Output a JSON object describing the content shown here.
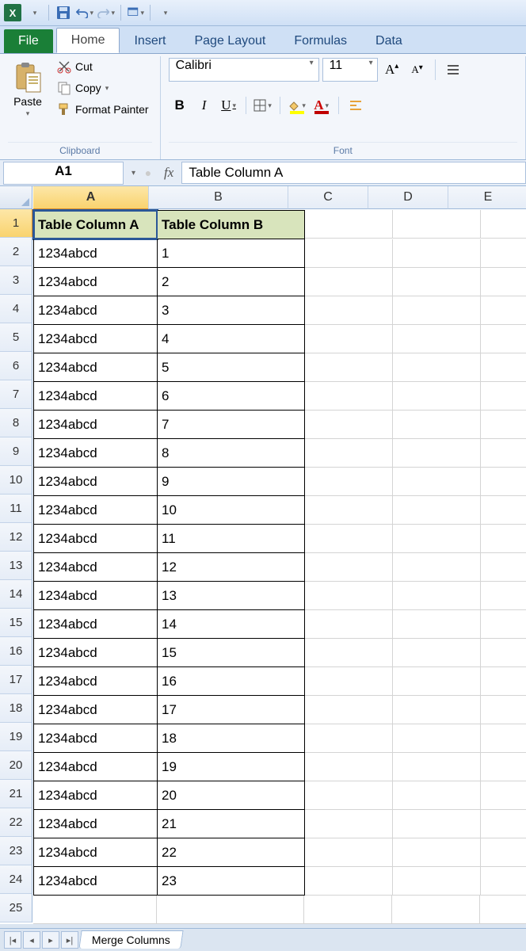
{
  "qat": {
    "save_title": "Save",
    "undo_title": "Undo",
    "redo_title": "Redo"
  },
  "tabs": {
    "file": "File",
    "home": "Home",
    "insert": "Insert",
    "page_layout": "Page Layout",
    "formulas": "Formulas",
    "data": "Data"
  },
  "ribbon": {
    "clipboard": {
      "label": "Clipboard",
      "paste": "Paste",
      "cut": "Cut",
      "copy": "Copy",
      "format_painter": "Format Painter"
    },
    "font": {
      "label": "Font",
      "name": "Calibri",
      "size": "11",
      "bold": "B",
      "italic": "I",
      "underline": "U"
    }
  },
  "namebox": {
    "ref": "A1",
    "fx": "fx",
    "formula": "Table Column A"
  },
  "columns": [
    "A",
    "B",
    "C",
    "D",
    "E"
  ],
  "row_count": 25,
  "table": {
    "headers": [
      "Table Column A",
      "Table Column B"
    ],
    "rows": [
      [
        "1234abcd",
        "1"
      ],
      [
        "1234abcd",
        "2"
      ],
      [
        "1234abcd",
        "3"
      ],
      [
        "1234abcd",
        "4"
      ],
      [
        "1234abcd",
        "5"
      ],
      [
        "1234abcd",
        "6"
      ],
      [
        "1234abcd",
        "7"
      ],
      [
        "1234abcd",
        "8"
      ],
      [
        "1234abcd",
        "9"
      ],
      [
        "1234abcd",
        "10"
      ],
      [
        "1234abcd",
        "11"
      ],
      [
        "1234abcd",
        "12"
      ],
      [
        "1234abcd",
        "13"
      ],
      [
        "1234abcd",
        "14"
      ],
      [
        "1234abcd",
        "15"
      ],
      [
        "1234abcd",
        "16"
      ],
      [
        "1234abcd",
        "17"
      ],
      [
        "1234abcd",
        "18"
      ],
      [
        "1234abcd",
        "19"
      ],
      [
        "1234abcd",
        "20"
      ],
      [
        "1234abcd",
        "21"
      ],
      [
        "1234abcd",
        "22"
      ],
      [
        "1234abcd",
        "23"
      ]
    ]
  },
  "sheet_tab": "Merge Columns",
  "active_cell": "A1"
}
